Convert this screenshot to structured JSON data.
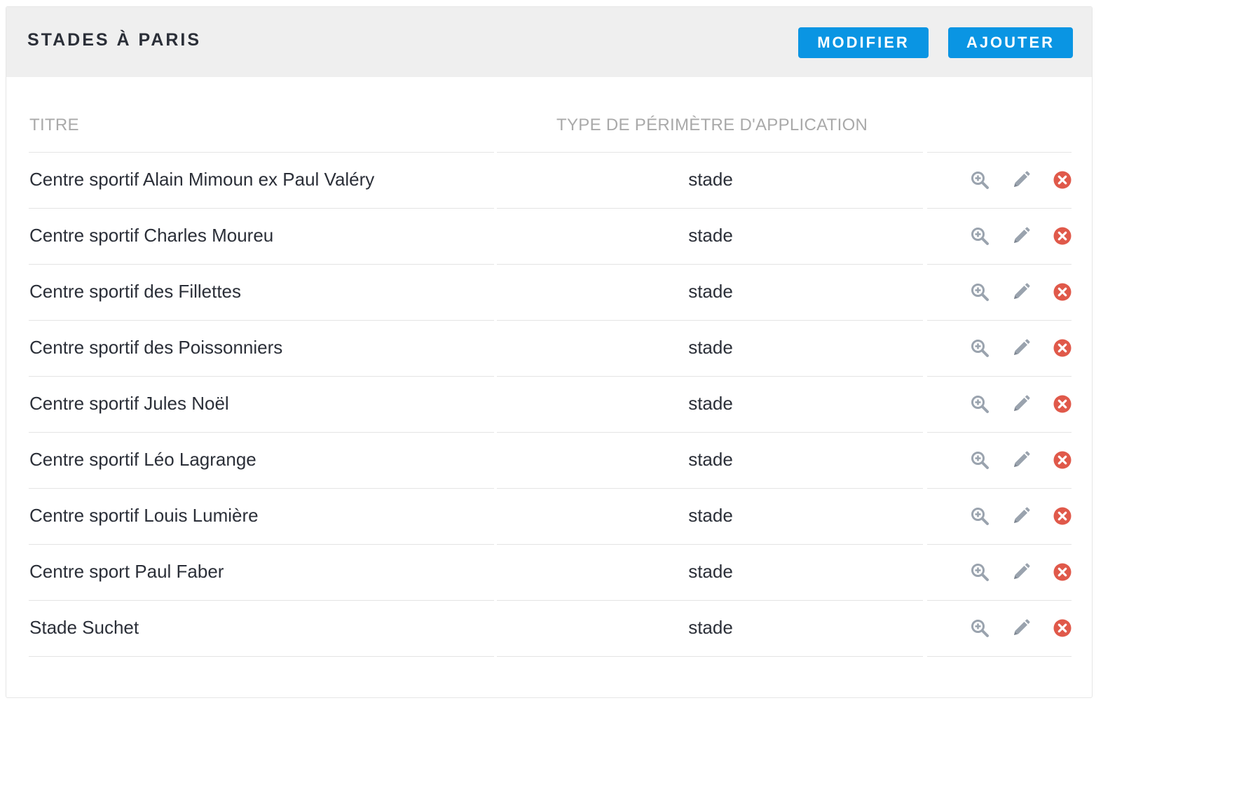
{
  "header": {
    "title": "STADES À PARIS",
    "modifier_label": "MODIFIER",
    "ajouter_label": "AJOUTER"
  },
  "table": {
    "columns": [
      "TITRE",
      "TYPE DE PÉRIMÈTRE D'APPLICATION"
    ],
    "rows": [
      {
        "title": "Centre sportif Alain Mimoun ex Paul Valéry",
        "type": "stade"
      },
      {
        "title": "Centre sportif Charles Moureu",
        "type": "stade"
      },
      {
        "title": "Centre sportif des Fillettes",
        "type": "stade"
      },
      {
        "title": "Centre sportif des Poissonniers",
        "type": "stade"
      },
      {
        "title": "Centre sportif Jules Noël",
        "type": "stade"
      },
      {
        "title": "Centre sportif Léo Lagrange",
        "type": "stade"
      },
      {
        "title": "Centre sportif Louis Lumière",
        "type": "stade"
      },
      {
        "title": "Centre sport Paul Faber",
        "type": "stade"
      },
      {
        "title": "Stade Suchet",
        "type": "stade"
      }
    ],
    "row_actions": [
      "zoom-in-icon",
      "pencil-icon",
      "delete-circle-icon"
    ]
  },
  "colors": {
    "accent": "#0a95e3",
    "header_bg": "#efefef",
    "icon_gray": "#9aa3ae",
    "delete_red": "#e0594a",
    "column_header_text": "#a9a9a9"
  }
}
